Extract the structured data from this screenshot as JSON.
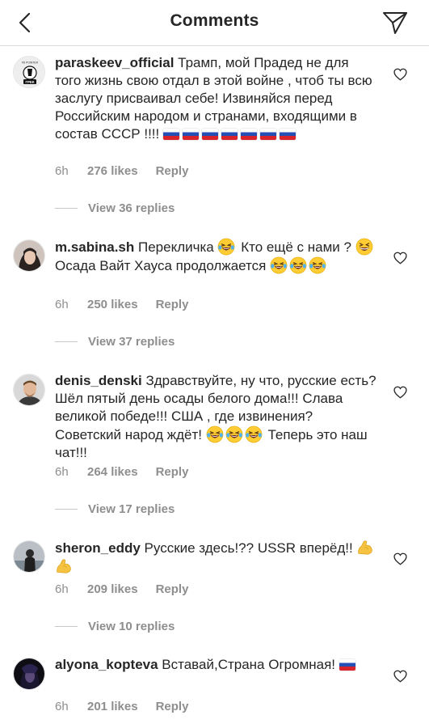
{
  "header": {
    "title": "Comments"
  },
  "comments": [
    {
      "username": "paraskeev_official",
      "text": "Трамп, мой Прадед не для того жизнь свою отдал в этой войне , чтоб ты всю заслугу присваивал себе! Извиняйся перед Российским народом и странами, входящими в состав СССР !!!!",
      "time": "6h",
      "likes": "276 likes",
      "reply": "Reply",
      "view_replies": "View 36 replies",
      "avatar_badge": "ГРЕК",
      "avatar_caption": "#S POINTER"
    },
    {
      "username": "m.sabina.sh",
      "text_a": "Перекличка",
      "text_b": "Кто ещё с нами ?",
      "text_c": "Осада Вайт Хауса продолжается",
      "time": "6h",
      "likes": "250 likes",
      "reply": "Reply",
      "view_replies": "View 37 replies"
    },
    {
      "username": "denis_denski",
      "text_a": "Здравствуйте, ну что, русские есть? Шёл пятый день осады белого дома!!! Слава великой победе!!! США , где извинения? Советский народ ждёт!",
      "text_b": "Теперь это наш чат!!!",
      "time": "6h",
      "likes": "264 likes",
      "reply": "Reply",
      "view_replies": "View 17 replies"
    },
    {
      "username": "sheron_eddy",
      "text": "Русские здесь!?? USSR вперёд!!",
      "time": "6h",
      "likes": "209 likes",
      "reply": "Reply",
      "view_replies": "View 10 replies"
    },
    {
      "username": "alyona_kopteva",
      "text": "Вставай,Страна Огромная!",
      "time": "6h",
      "likes": "201 likes",
      "reply": "Reply"
    }
  ],
  "icons": {
    "back": "chevron-left-icon",
    "send": "paper-plane-icon",
    "like": "heart-outline-icon",
    "flag": "russia-flag-emoji",
    "laugh": "tears-of-joy-emoji",
    "grin": "squinting-grin-emoji",
    "muscle": "flexed-biceps-emoji"
  },
  "colors": {
    "text": "#262626",
    "secondary": "#8e8e8e",
    "divider": "#dbdbdb"
  }
}
